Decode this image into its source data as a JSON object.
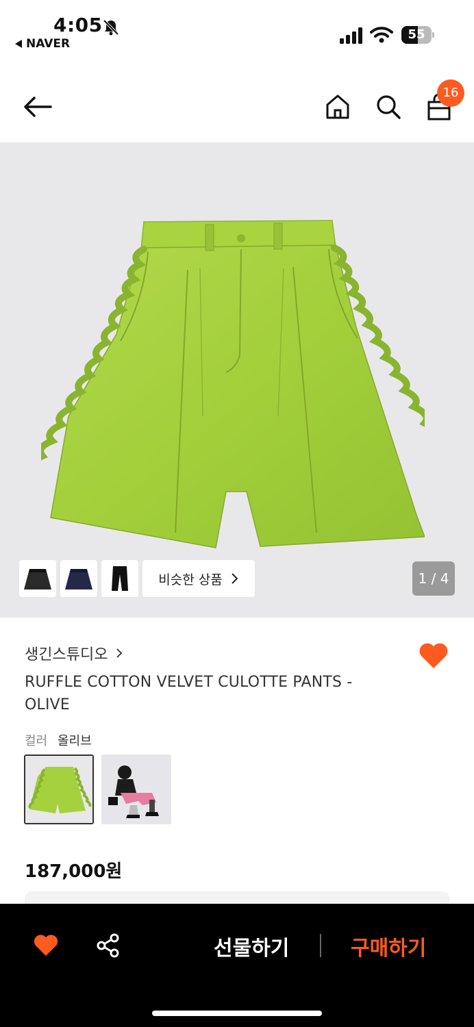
{
  "status_bar": {
    "time": "4:05",
    "back_app": "NAVER",
    "battery": "55",
    "battery_level": 0.55
  },
  "nav": {
    "cart_count": "16"
  },
  "hero": {
    "similar_button": "비슷한 상품",
    "page_indicator": "1 / 4"
  },
  "product": {
    "brand": "생긴스튜디오",
    "title": "RUFFLE COTTON VELVET CULOTTE PANTS - OLIVE",
    "color_label": "컬러",
    "color_value": "올리브",
    "price": "187,000원"
  },
  "bottom_bar": {
    "gift_label": "선물하기",
    "buy_label": "구매하기"
  },
  "colors": {
    "accent": "#ff5a1f",
    "product_green": "#a6d13f",
    "hero_bg": "#e8e8ea"
  }
}
